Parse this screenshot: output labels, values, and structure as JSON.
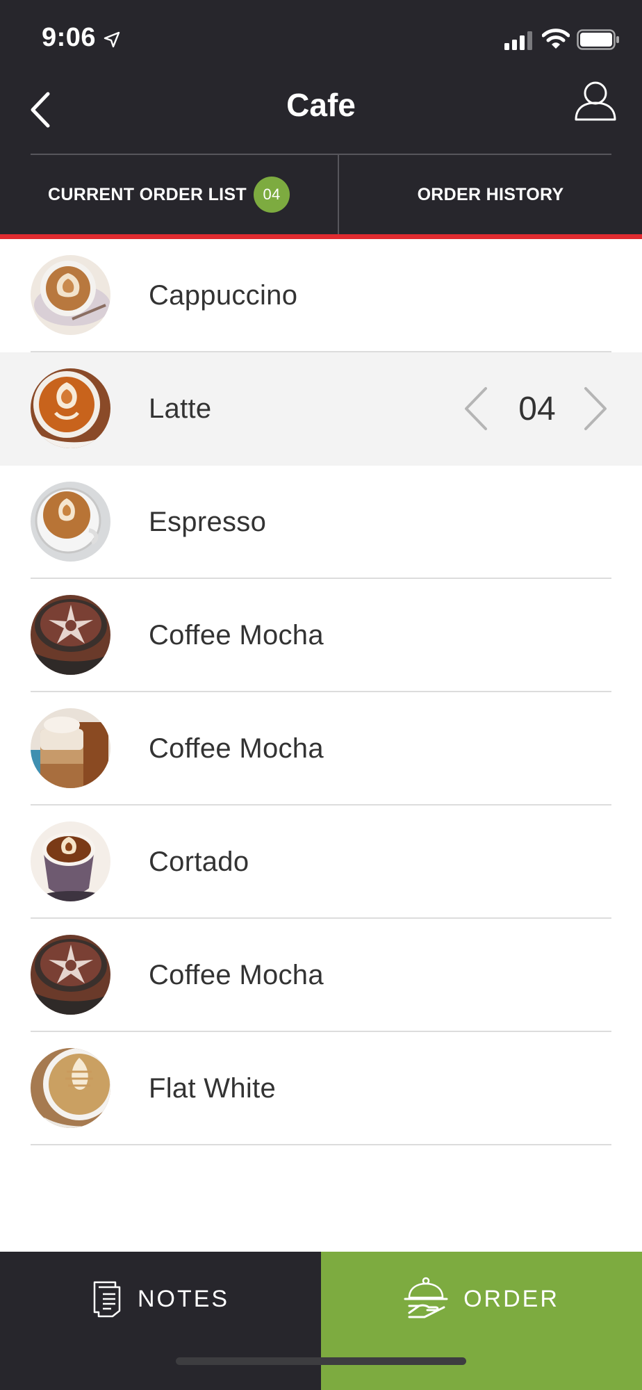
{
  "status_bar": {
    "time": "9:06"
  },
  "nav": {
    "title": "Cafe"
  },
  "tabs": {
    "current_label": "CURRENT ORDER LIST",
    "current_badge": "04",
    "history_label": "ORDER HISTORY"
  },
  "colors": {
    "header_bg": "#27262c",
    "accent_green": "#7dab40",
    "accent_red": "#e02b30",
    "selected_row_bg": "#f3f3f3"
  },
  "items": [
    {
      "name": "Cappuccino"
    },
    {
      "name": "Latte",
      "quantity": "04",
      "selected": true
    },
    {
      "name": "Espresso"
    },
    {
      "name": "Coffee Mocha"
    },
    {
      "name": "Coffee Mocha"
    },
    {
      "name": "Cortado"
    },
    {
      "name": "Coffee Mocha"
    },
    {
      "name": "Flat White"
    }
  ],
  "bottom_bar": {
    "notes_label": "NOTES",
    "order_label": "ORDER"
  },
  "icons": [
    "location-arrow-icon",
    "signal-icon",
    "wifi-icon",
    "battery-icon",
    "back-chevron-icon",
    "profile-icon",
    "chevron-left-icon",
    "chevron-right-icon",
    "notes-icon",
    "cloche-icon"
  ]
}
